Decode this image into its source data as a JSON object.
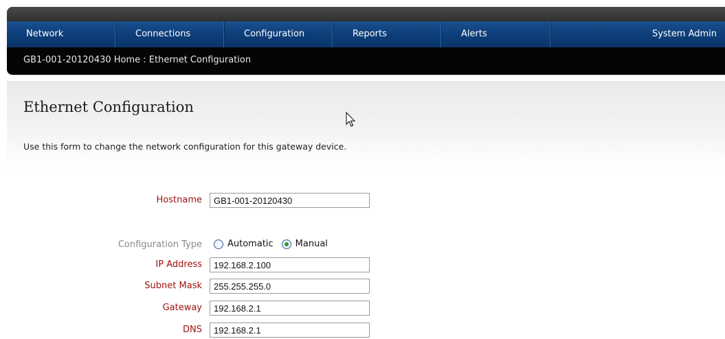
{
  "nav": {
    "items": [
      "Network",
      "Connections",
      "Configuration",
      "Reports",
      "Alerts"
    ],
    "right_item": "System Admin"
  },
  "breadcrumb": "GB1-001-20120430 Home : Ethernet Configuration",
  "page": {
    "title": "Ethernet Configuration",
    "description": "Use this form to change the network configuration for this gateway device."
  },
  "form": {
    "hostname": {
      "label": "Hostname",
      "value": "GB1-001-20120430"
    },
    "config_type": {
      "label": "Configuration Type",
      "options": [
        "Automatic",
        "Manual"
      ],
      "selected": "Manual"
    },
    "ip_address": {
      "label": "IP Address",
      "value": "192.168.2.100"
    },
    "subnet_mask": {
      "label": "Subnet Mask",
      "value": "255.255.255.0"
    },
    "gateway": {
      "label": "Gateway",
      "value": "192.168.2.1"
    },
    "dns": {
      "label": "DNS",
      "value": "192.168.2.1"
    }
  },
  "colors": {
    "nav_bg": "#0d3d78",
    "breadcrumb_bg": "#050505",
    "required_label": "#a01010",
    "optional_label": "#888888"
  }
}
